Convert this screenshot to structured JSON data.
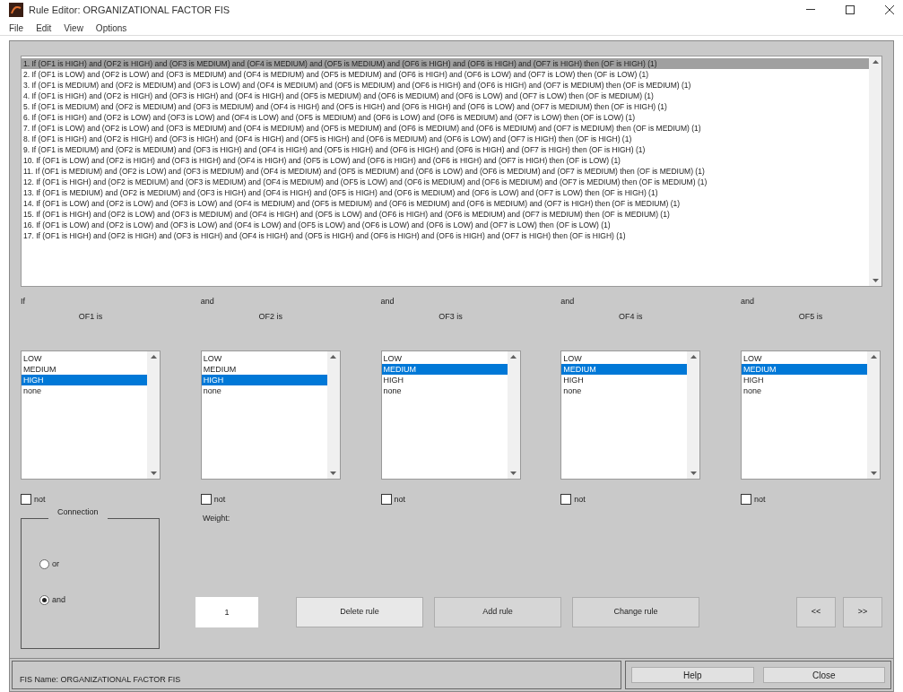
{
  "window": {
    "title": "Rule Editor: ORGANIZATIONAL FACTOR FIS"
  },
  "menu": [
    "File",
    "Edit",
    "View",
    "Options"
  ],
  "rules": [
    {
      "text": "1. If (OF1 is HIGH) and (OF2 is HIGH) and (OF3 is MEDIUM) and (OF4 is MEDIUM) and (OF5 is MEDIUM) and (OF6 is HIGH) and (OF6 is HIGH) and (OF7 is HIGH) then (OF is HIGH) (1)",
      "selected": true
    },
    {
      "text": "2. If (OF1 is LOW) and (OF2 is LOW) and (OF3 is MEDIUM) and (OF4 is MEDIUM) and (OF5 is MEDIUM) and (OF6 is HIGH) and (OF6 is LOW) and (OF7 is LOW) then (OF is LOW) (1)",
      "selected": false
    },
    {
      "text": "3. If (OF1 is MEDIUM) and (OF2 is MEDIUM) and (OF3 is LOW) and (OF4 is MEDIUM) and (OF5 is MEDIUM) and (OF6 is HIGH) and (OF6 is HIGH) and (OF7 is MEDIUM) then (OF is MEDIUM) (1)",
      "selected": false
    },
    {
      "text": "4. If (OF1 is HIGH) and (OF2 is HIGH) and (OF3 is HIGH) and (OF4 is HIGH) and (OF5 is MEDIUM) and (OF6 is MEDIUM) and (OF6 is LOW) and (OF7 is LOW) then (OF is MEDIUM) (1)",
      "selected": false
    },
    {
      "text": "5. If (OF1 is MEDIUM) and (OF2 is MEDIUM) and (OF3 is MEDIUM) and (OF4 is HIGH) and (OF5 is HIGH) and (OF6 is HIGH) and (OF6 is LOW) and (OF7 is MEDIUM) then (OF is HIGH) (1)",
      "selected": false
    },
    {
      "text": "6. If (OF1 is HIGH) and (OF2 is LOW) and (OF3 is LOW) and (OF4 is LOW) and (OF5 is MEDIUM) and (OF6 is LOW) and (OF6 is MEDIUM) and (OF7 is LOW) then (OF is LOW) (1)",
      "selected": false
    },
    {
      "text": "7. If (OF1 is LOW) and (OF2 is LOW) and (OF3 is MEDIUM) and (OF4 is MEDIUM) and (OF5 is MEDIUM) and (OF6 is MEDIUM) and (OF6 is MEDIUM) and (OF7 is MEDIUM) then (OF is MEDIUM) (1)",
      "selected": false
    },
    {
      "text": "8. If (OF1 is HIGH) and (OF2 is HIGH) and (OF3 is HIGH) and (OF4 is HIGH) and (OF5 is HIGH) and (OF6 is MEDIUM) and (OF6 is LOW) and (OF7 is HIGH) then (OF is HIGH) (1)",
      "selected": false
    },
    {
      "text": "9. If (OF1 is MEDIUM) and (OF2 is MEDIUM) and (OF3 is HIGH) and (OF4 is HIGH) and (OF5 is HIGH) and (OF6 is HIGH) and (OF6 is HIGH) and (OF7 is HIGH) then (OF is HIGH) (1)",
      "selected": false
    },
    {
      "text": "10. If (OF1 is LOW) and (OF2 is HIGH) and (OF3 is HIGH) and (OF4 is HIGH) and (OF5 is LOW) and (OF6 is HIGH) and (OF6 is HIGH) and (OF7 is HIGH) then (OF is LOW) (1)",
      "selected": false
    },
    {
      "text": "11. If (OF1 is MEDIUM) and (OF2 is LOW) and (OF3 is MEDIUM) and (OF4 is MEDIUM) and (OF5 is MEDIUM) and (OF6 is LOW) and (OF6 is MEDIUM) and (OF7 is MEDIUM) then (OF is MEDIUM) (1)",
      "selected": false
    },
    {
      "text": "12. If (OF1 is HIGH) and (OF2 is MEDIUM) and (OF3 is MEDIUM) and (OF4 is MEDIUM) and (OF5 is LOW) and (OF6 is MEDIUM) and (OF6 is MEDIUM) and (OF7 is MEDIUM) then (OF is MEDIUM) (1)",
      "selected": false
    },
    {
      "text": "13. If (OF1 is MEDIUM) and (OF2 is MEDIUM) and (OF3 is HIGH) and (OF4 is HIGH) and (OF5 is HIGH) and (OF6 is MEDIUM) and (OF6 is LOW) and (OF7 is LOW) then (OF is HIGH) (1)",
      "selected": false
    },
    {
      "text": "14. If (OF1 is LOW) and (OF2 is LOW) and (OF3 is LOW) and (OF4 is MEDIUM) and (OF5 is MEDIUM) and (OF6 is MEDIUM) and (OF6 is MEDIUM) and (OF7 is HIGH) then (OF is MEDIUM) (1)",
      "selected": false
    },
    {
      "text": "15. If (OF1 is HIGH) and (OF2 is LOW) and (OF3 is MEDIUM) and (OF4 is HIGH) and (OF5 is LOW) and (OF6 is HIGH) and (OF6 is MEDIUM) and (OF7 is MEDIUM) then (OF is MEDIUM) (1)",
      "selected": false
    },
    {
      "text": "16. If (OF1 is LOW) and (OF2 is LOW) and (OF3 is LOW) and (OF4 is LOW) and (OF5 is LOW) and (OF6 is LOW) and (OF6 is LOW) and (OF7 is LOW) then (OF is LOW) (1)",
      "selected": false
    },
    {
      "text": "17. If (OF1 is HIGH) and (OF2 is HIGH) and (OF3 is HIGH) and (OF4 is HIGH) and (OF5 is HIGH) and (OF6 is HIGH) and (OF6 is HIGH) and (OF7 is HIGH) then (OF is HIGH) (1)",
      "selected": false
    }
  ],
  "inputs": [
    {
      "connective": "If",
      "label": "OF1 is",
      "options": [
        {
          "text": "LOW",
          "selected": false
        },
        {
          "text": "MEDIUM",
          "selected": false
        },
        {
          "text": "HIGH",
          "selected": true
        },
        {
          "text": "none",
          "selected": false
        }
      ],
      "not": {
        "label": "not",
        "checked": false
      }
    },
    {
      "connective": "and",
      "label": "OF2 is",
      "options": [
        {
          "text": "LOW",
          "selected": false
        },
        {
          "text": "MEDIUM",
          "selected": false
        },
        {
          "text": "HIGH",
          "selected": true
        },
        {
          "text": "none",
          "selected": false
        }
      ],
      "not": {
        "label": "not",
        "checked": false
      }
    },
    {
      "connective": "and",
      "label": "OF3 is",
      "options": [
        {
          "text": "LOW",
          "selected": false
        },
        {
          "text": "MEDIUM",
          "selected": true
        },
        {
          "text": "HIGH",
          "selected": false
        },
        {
          "text": "none",
          "selected": false
        }
      ],
      "not": {
        "label": "not",
        "checked": false
      }
    },
    {
      "connective": "and",
      "label": "OF4 is",
      "options": [
        {
          "text": "LOW",
          "selected": false
        },
        {
          "text": "MEDIUM",
          "selected": true
        },
        {
          "text": "HIGH",
          "selected": false
        },
        {
          "text": "none",
          "selected": false
        }
      ],
      "not": {
        "label": "not",
        "checked": false
      }
    },
    {
      "connective": "and",
      "label": "OF5 is",
      "options": [
        {
          "text": "LOW",
          "selected": false
        },
        {
          "text": "MEDIUM",
          "selected": true
        },
        {
          "text": "HIGH",
          "selected": false
        },
        {
          "text": "none",
          "selected": false
        }
      ],
      "not": {
        "label": "not",
        "checked": false
      }
    }
  ],
  "connection": {
    "title": "Connection",
    "options": [
      {
        "label": "or",
        "selected": false
      },
      {
        "label": "and",
        "selected": true
      }
    ]
  },
  "weight": {
    "label": "Weight:",
    "value": "1"
  },
  "buttons": [
    "Delete rule",
    "Add rule",
    "Change rule"
  ],
  "nav_buttons": [
    "<<",
    ">>"
  ],
  "status": "FIS Name: ORGANIZATIONAL FACTOR FIS",
  "footer_buttons": [
    "Help",
    "Close"
  ]
}
